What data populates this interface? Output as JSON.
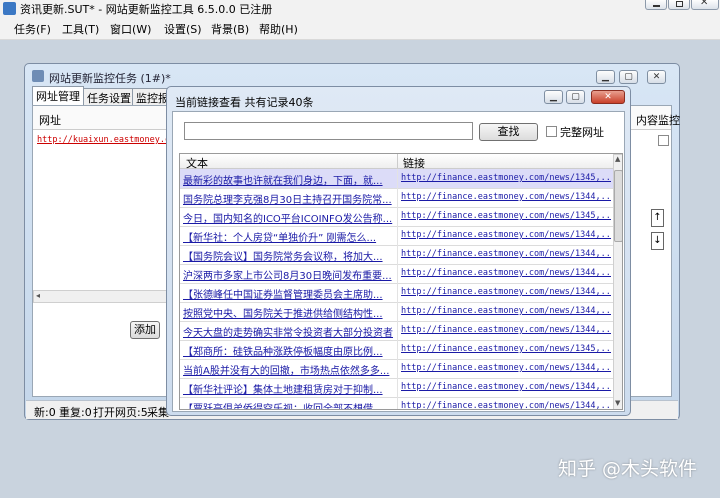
{
  "app": {
    "title": "资讯更新.SUT* - 网站更新监控工具 6.5.0.0 已注册"
  },
  "menu": [
    "任务(F)",
    "工具(T)",
    "窗口(W)",
    "设置(S)",
    "背景(B)",
    "帮助(H)"
  ],
  "task_window": {
    "title": "网站更新监控任务 (1#)*",
    "tabs": [
      "网址管理",
      "任务设置",
      "监控报"
    ],
    "col_url": "网址",
    "col_monitor": "内容监控",
    "url_value": "http://kuaixun.eastmoney.co",
    "add_label": "添加",
    "status": [
      "新:0",
      "重复:0",
      "打开网页:5",
      "采集"
    ]
  },
  "link_dialog": {
    "title": "当前链接查看  共有记录40条",
    "search_value": "",
    "search_button": "查找",
    "full_url_label": "完整网址",
    "col_text": "文本",
    "col_link": "链接",
    "rows": [
      {
        "text": "最新彩的故事也许就在我们身边，下面，就...",
        "url": "http://finance.eastmoney.com/news/1345,..."
      },
      {
        "text": "国务院总理李克强8月30日主持召开国务院常...",
        "url": "http://finance.eastmoney.com/news/1344,..."
      },
      {
        "text": "今日，国内知名的ICO平台ICOINFO发公告称...",
        "url": "http://finance.eastmoney.com/news/1345,..."
      },
      {
        "text": "【新华社：个人房贷“单独价升” 刚需怎么...",
        "url": "http://finance.eastmoney.com/news/1344,..."
      },
      {
        "text": "【国务院会议】国务院常务会议称，将加大...",
        "url": "http://finance.eastmoney.com/news/1344,..."
      },
      {
        "text": "沪深两市多家上市公司8月30日晚间发布重要...",
        "url": "http://finance.eastmoney.com/news/1344,..."
      },
      {
        "text": "【张德峰任中国证券监督管理委员会主席助...",
        "url": "http://finance.eastmoney.com/news/1344,..."
      },
      {
        "text": "按照党中央、国务院关于推进供给侧结构性...",
        "url": "http://finance.eastmoney.com/news/1344,..."
      },
      {
        "text": "今天大盘的走势确实非常令投资者大部分投资者...",
        "url": "http://finance.eastmoney.com/news/1344,..."
      },
      {
        "text": "【郑商所：硅铁品种涨跌停板幅度由原比例...",
        "url": "http://finance.eastmoney.com/news/1345,..."
      },
      {
        "text": "当前A股并没有大的回撤，市场热点依然多多...",
        "url": "http://finance.eastmoney.com/news/1344,..."
      },
      {
        "text": "【新华社评论】集体土地建租赁房对于抑制...",
        "url": "http://finance.eastmoney.com/news/1344,..."
      },
      {
        "text": "【贾跃亭俱弟侨得空乐视：收回全部不想借...",
        "url": "http://finance.eastmoney.com/news/1344,..."
      }
    ]
  },
  "watermark": "知乎 @木头软件"
}
